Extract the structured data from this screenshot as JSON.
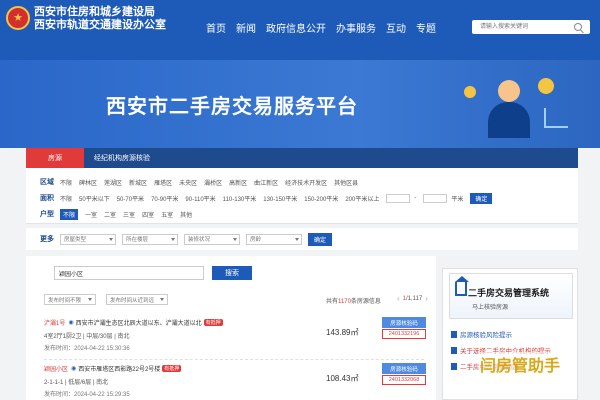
{
  "header": {
    "title_line1": "西安市住房和城乡建设局",
    "title_line2": "西安市轨道交通建设办公室",
    "nav": [
      "首页",
      "新闻",
      "政府信息公开",
      "办事服务",
      "互动",
      "专题"
    ],
    "search_placeholder": "请输入搜索关键词"
  },
  "banner": {
    "title": "西安市二手房交易服务平台"
  },
  "category_bar": {
    "active": "房源",
    "tabs": [
      "经纪机构房源核验"
    ]
  },
  "filters": {
    "district": {
      "label": "区域",
      "options": [
        "不限",
        "碑林区",
        "莲湖区",
        "新城区",
        "雁塔区",
        "未央区",
        "灞桥区",
        "高新区",
        "曲江新区",
        "经济技术开发区",
        "其他区县"
      ]
    },
    "area": {
      "label": "面积",
      "options": [
        "不限",
        "50平米以下",
        "50-70平米",
        "70-90平米",
        "90-110平米",
        "110-130平米",
        "130-150平米",
        "150-200平米",
        "200平米以上"
      ],
      "unit": "平米",
      "confirm": "确定"
    },
    "layout": {
      "label": "户型",
      "selected": "不限",
      "options": [
        "一室",
        "二室",
        "三室",
        "四室",
        "五室",
        "其他"
      ]
    }
  },
  "more": {
    "label": "更多",
    "selects": [
      "房屋类型",
      "所在楼层",
      "装修状况",
      "房龄"
    ],
    "confirm": "确定"
  },
  "list": {
    "keyword": "颖园小区",
    "search_btn": "搜索",
    "sort1": "发布时间不限",
    "sort2": "发布时间从近到远",
    "total_prefix": "共有",
    "total_count": "1170",
    "total_suffix": "条房源信息",
    "page_current": "1",
    "page_total": "/1,117",
    "items": [
      {
        "tag": "浐灞1号",
        "address": "西安市浐灞生态区北辰大道以东、浐灞大道以北",
        "badge": "有抵押",
        "detail": "4室2厅1厨2卫 | 中层/30层 | 南北",
        "time": "发布时间：2024-04-22 15:30:36",
        "area": "143.89㎡",
        "verify_label": "房源核验码",
        "verify_code": "2401332196"
      },
      {
        "tag": "颖园小区",
        "address": "西安市雁塔区西影路22号2号楼",
        "badge": "有抵押",
        "detail": "2-1-1-1 | 低层/6层 | 南北",
        "time": "发布时间：2024-04-22 15:29:35",
        "area": "108.43㎡",
        "verify_label": "房源核验码",
        "verify_code": "2401332068"
      }
    ]
  },
  "side": {
    "card_title": "二手房交易管理系统",
    "card_sub": "马上核验房源",
    "links": [
      "房源核验风险提示",
      "关于选择二手房中介机构的提示",
      "二手房中介常见问题"
    ],
    "watermark": "闫房管助手"
  },
  "colors": {
    "primary": "#1e5bb8",
    "accent_red": "#e03a3a",
    "dark_bar": "#1e4a8e"
  }
}
